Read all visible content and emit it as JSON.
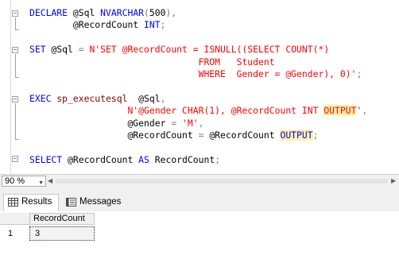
{
  "editor": {
    "lines": [
      [
        [
          "kw",
          "DECLARE "
        ],
        [
          "var",
          "@Sql "
        ],
        [
          "kw",
          "NVARCHAR"
        ],
        [
          "gry",
          "("
        ],
        [
          "var",
          "500"
        ],
        [
          "gry",
          "),"
        ]
      ],
      [
        [
          "var",
          "        @RecordCount "
        ],
        [
          "kw",
          "INT"
        ],
        [
          "gry",
          ";"
        ]
      ],
      [],
      [
        [
          "kw",
          "SET "
        ],
        [
          "var",
          "@Sql "
        ],
        [
          "gry",
          "= "
        ],
        [
          "str",
          "N'SET @RecordCount = ISNULL((SELECT COUNT(*)"
        ]
      ],
      [
        [
          "str",
          "                               FROM   Student"
        ]
      ],
      [
        [
          "str",
          "                               WHERE  Gender = @Gender), 0)'"
        ],
        [
          "gry",
          ";"
        ]
      ],
      [],
      [
        [
          "kw",
          "EXEC "
        ],
        [
          "pr",
          "sp_executesql  "
        ],
        [
          "var",
          "@Sql"
        ],
        [
          "gry",
          ","
        ]
      ],
      [
        [
          "str",
          "                  N'@Gender CHAR(1), @RecordCount INT "
        ],
        [
          "strhl",
          "OUTPUT"
        ],
        [
          "str",
          "'"
        ],
        [
          "gry",
          ","
        ]
      ],
      [
        [
          "var",
          "                  @Gender "
        ],
        [
          "gry",
          "= "
        ],
        [
          "str",
          "'M'"
        ],
        [
          "gry",
          ","
        ]
      ],
      [
        [
          "var",
          "                  @RecordCount "
        ],
        [
          "gry",
          "= "
        ],
        [
          "var",
          "@RecordCount "
        ],
        [
          "kwhl",
          "OUTPUT"
        ],
        [
          "gry",
          ";"
        ]
      ],
      [],
      [
        [
          "kw",
          "SELECT "
        ],
        [
          "var",
          "@RecordCount "
        ],
        [
          "kw",
          "AS "
        ],
        [
          "var",
          "RecordCount"
        ],
        [
          "gry",
          ";"
        ]
      ]
    ]
  },
  "status": {
    "zoom_value": "90 %"
  },
  "tabs": {
    "results_label": "Results",
    "messages_label": "Messages"
  },
  "grid": {
    "columns": [
      "RecordCount"
    ],
    "rows": [
      {
        "row_number": "1",
        "cells": [
          "3"
        ]
      }
    ]
  },
  "icons": {
    "results_tab_icon": "grid-icon",
    "messages_tab_icon": "messages-icon",
    "zoom_dropdown_icon": "chevron-down-icon"
  },
  "colors": {
    "keyword": "#0000ff",
    "string": "#ff0000",
    "highlight": "#fff2a8"
  }
}
